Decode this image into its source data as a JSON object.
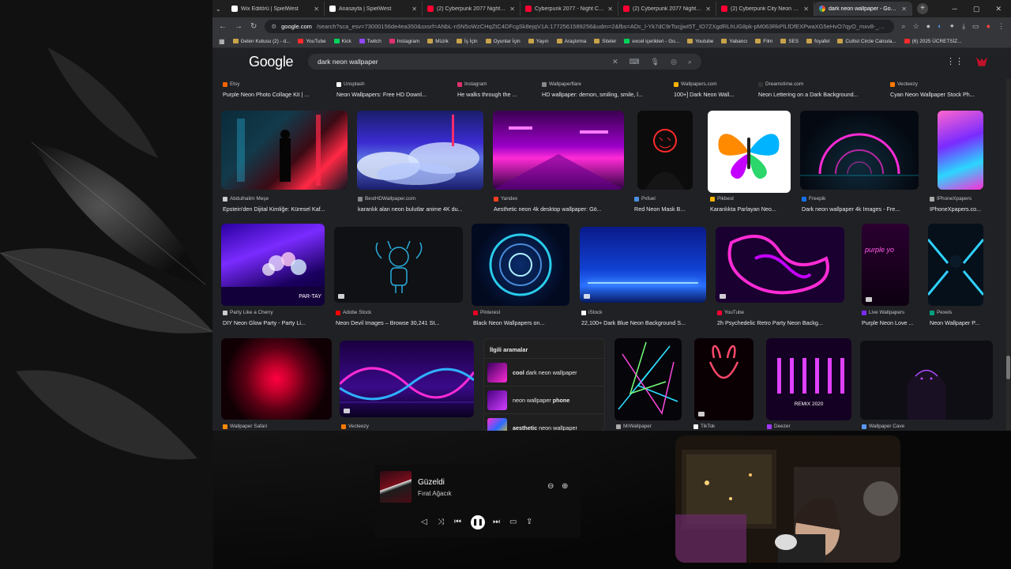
{
  "tabs": [
    {
      "label": "Wix Editörü | SpielWest",
      "favicon": "wix"
    },
    {
      "label": "Anasayfa | SpielWest",
      "favicon": "wix"
    },
    {
      "label": "(2) Cyberpunk 2077 Night City",
      "favicon": "yt"
    },
    {
      "label": "Cyberpunk 2077 - Night City -",
      "favicon": "yt"
    },
    {
      "label": "(2) Cyberpunk 2077 Night City",
      "favicon": "yt"
    },
    {
      "label": "(2) Cyberpunk City Neon Night",
      "favicon": "yt"
    },
    {
      "label": "dark neon wallpaper - Google",
      "favicon": "g",
      "active": true
    }
  ],
  "address": {
    "host": "google.com",
    "path": "/search?sca_esv=73000156de4ea350&sxsrf=ANbL-n5N5oWzCHqZtC4DFcgSk8ejqV1A:1772561589256&udm=2&fbs=ADc_l-Yk7dC9rTocjjwI5T_IO7ZXgdRLhUG8pk-pM063RkPlLfDfEXPwaXG5eHvO7qyO_mxv8-_pt2..."
  },
  "bookmarks": [
    {
      "label": "Gelen Kutusu (2) - d...",
      "icon": "mail"
    },
    {
      "label": "YouTube",
      "icon": "red"
    },
    {
      "label": "Kick",
      "icon": "green"
    },
    {
      "label": "Twitch",
      "icon": "pur"
    },
    {
      "label": "Instagram",
      "icon": "pink"
    },
    {
      "label": "Müzik",
      "icon": "folder"
    },
    {
      "label": "İş İçin",
      "icon": "folder"
    },
    {
      "label": "Oyunlar İçin",
      "icon": "folder"
    },
    {
      "label": "Yayın",
      "icon": "folder"
    },
    {
      "label": "Araştırma",
      "icon": "folder"
    },
    {
      "label": "Siteler",
      "icon": "folder"
    },
    {
      "label": "excel içerikleri - Go...",
      "icon": "green"
    },
    {
      "label": "Youtube",
      "icon": "folder"
    },
    {
      "label": "Yabancı",
      "icon": "folder"
    },
    {
      "label": "Film",
      "icon": "folder"
    },
    {
      "label": "SES",
      "icon": "folder"
    },
    {
      "label": "foyafet",
      "icon": "folder"
    },
    {
      "label": "Cultist Circle Calcula...",
      "icon": "folder"
    },
    {
      "label": "(6) 2025 ÜCRETSİZ...",
      "icon": "red"
    }
  ],
  "google": {
    "logo": "Google",
    "query": "dark neon wallpaper"
  },
  "rows": [
    {
      "captions": [
        {
          "src": "Etsy",
          "title": "Purple Neon Photo Collage Kit | ..."
        },
        {
          "src": "Unsplash",
          "title": "Neon Wallpapers: Free HD Downl..."
        },
        {
          "src": "Instagram",
          "title": "He walks through the ..."
        },
        {
          "src": "Wallpaperflare",
          "title": "HD wallpaper: demon, smiling, smile, l..."
        },
        {
          "src": "Wallpapers.com",
          "title": "100+] Dark Neon Wall..."
        },
        {
          "src": "Dreamstime.com",
          "title": "Neon Lettering on a Dark Background..."
        },
        {
          "src": "Vecteezy",
          "title": "Cyan Neon Wallpaper Stock Ph..."
        }
      ]
    },
    {
      "captions": [
        {
          "src": "Abdulhalim Meşe",
          "title": "Epstein'den Dijital Kimliğe: Küresel Kaf..."
        },
        {
          "src": "BestHDWallpaper.com",
          "title": "karanlık alan neon bulutlar anime 4K du..."
        },
        {
          "src": "Yandex",
          "title": "Aesthetic neon 4k desktop wallpaper: Gö..."
        },
        {
          "src": "Pxfuel",
          "title": "Red Neon Mask B..."
        },
        {
          "src": "Pikbest",
          "title": "Karanlıkta Parlayan Neo..."
        },
        {
          "src": "Freepik",
          "title": "Dark neon wallpaper 4k Images - Fre..."
        },
        {
          "src": "IPhoneXpapers",
          "title": "IPhoneXpapers.co..."
        }
      ]
    },
    {
      "captions": [
        {
          "src": "Party Like a Cherry",
          "title": "DIY Neon Glow Party - Party Li..."
        },
        {
          "src": "Adobe Stock",
          "title": "Neon Devil Images – Browse 30,241 St..."
        },
        {
          "src": "Pinterest",
          "title": "Black Neon Wallpapers on..."
        },
        {
          "src": "iStock",
          "title": "22,100+ Dark Blue Neon Background S..."
        },
        {
          "src": "YouTube",
          "title": "2h Psychedelic Retro Party Neon Backg..."
        },
        {
          "src": "Live Wallpapers",
          "title": "Purple Neon Love ..."
        },
        {
          "src": "Pexels",
          "title": "Neon Wallpaper P..."
        }
      ]
    },
    {
      "captions": [
        {
          "src": "Wallpaper Safari",
          "title": ""
        },
        {
          "src": "Vecteezy",
          "title": ""
        },
        {
          "src": "MrWallpaper",
          "title": ""
        },
        {
          "src": "TikTok",
          "title": ""
        },
        {
          "src": "Deezer",
          "title": ""
        },
        {
          "src": "Wallpaper Cave",
          "title": ""
        }
      ]
    }
  ],
  "thumb_overlays": {
    "party_text": "PAR-TAY",
    "remix_text": "REMIX 2020",
    "purple_text": "purple yo"
  },
  "related": {
    "heading": "İlgili aramalar",
    "items": [
      {
        "bold_prefix": "cool",
        "text": " dark neon wallpaper",
        "bold_suffix": ""
      },
      {
        "bold_prefix": "",
        "text": "neon wallpaper ",
        "bold_suffix": "phone"
      },
      {
        "bold_prefix": "aesthetic",
        "text": " neon wallpaper",
        "bold_suffix": ""
      }
    ]
  },
  "player": {
    "title": "Güzeldi",
    "artist": "Fırat Ağacık"
  },
  "colors": {
    "accent_red": "#c0122a",
    "page_bg": "#202124",
    "neon_pink": "#ff2bd6",
    "neon_cyan": "#00e5ff"
  }
}
